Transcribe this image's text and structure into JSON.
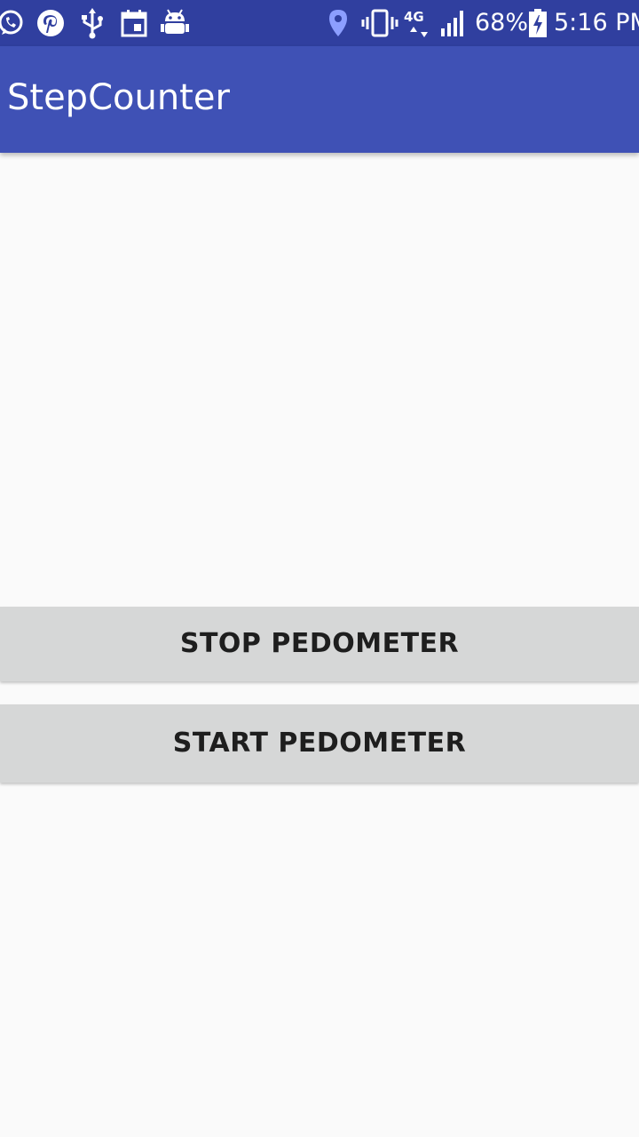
{
  "status_bar": {
    "left_icons": [
      "whatsapp-icon",
      "pinterest-icon",
      "usb-icon",
      "calendar-icon",
      "android-debug-icon"
    ],
    "right_icons": [
      "location-icon",
      "vibrate-icon",
      "network-4g-icon",
      "signal-icon",
      "battery-charging-icon"
    ],
    "network_label": "4G",
    "battery_percent": "68%",
    "time": "5:16 PM",
    "background_color": "#303f9f"
  },
  "app_bar": {
    "title": "StepCounter",
    "background_color": "#3f51b5"
  },
  "main": {
    "stop_button_label": "STOP PEDOMETER",
    "start_button_label": "START PEDOMETER",
    "button_color": "#d6d7d7"
  }
}
